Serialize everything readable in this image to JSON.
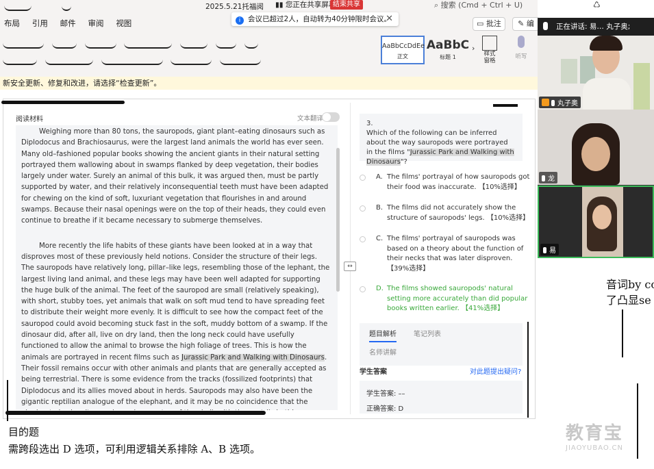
{
  "titlebar": {
    "doc_title": "2025.5.21托福阅",
    "share_status": "您正在共享屏幕",
    "stop_share": "结束共享",
    "search_placeholder": "搜索 (Cmd + Ctrl + U)"
  },
  "ribbon": {
    "tabs": [
      "布局",
      "引用",
      "邮件",
      "审阅",
      "视图"
    ],
    "comment_button": "批注",
    "edit_button": "编",
    "style_normal_sample": "AaBbCcDdEe",
    "style_normal_label": "正文",
    "style_h1_sample": "AaBbC",
    "style_h1_label": "标题 1",
    "style_pane_label": "样式\n窗格",
    "dictate_label": "听写",
    "update_hint": "新安全更新、修复和改进，请选择“检查更新”。"
  },
  "meeting": {
    "banner": "会议已超过2人，自动转为40分钟限时会议。",
    "speaking_label": "正在讲话:",
    "speaking_names": "易… 丸子奥;",
    "participants": [
      {
        "name": "丸子奥",
        "host": true
      },
      {
        "name": "龙",
        "host": false
      },
      {
        "name": "易",
        "host": false
      }
    ]
  },
  "reading": {
    "panel_title": "阅读材料",
    "translate_label": "文本翻译",
    "para1": "Weighing more than 80 tons, the sauropods, giant plant–eating dinosaurs such as Diplodocus and Brachiosaurus, were the largest land animals the world has ever seen. Many old–fashioned popular books showing the ancient giants in their natural setting portrayed them wallowing about in swamps flanked by deep vegetation, their bodies largely under water. Surely an animal of this bulk, it was argued then, must be partly supported by water, and their relatively inconsequential teeth must have been adapted for chewing on the kind of soft, luxuriant vegetation that flourishes in and around swamps. Because their nasal openings were on the top of their heads, they could even continue to breathe if it became necessary to submerge themselves.",
    "para2_before": "More recently the life habits of these giants have been looked at in a way that disproves most of these previously held notions. Consider the structure of their legs. The sauropods have relatively long, pillar–like legs, resembling those of the lephant, the largest living land animal, and these legs may have been well adapted for supporting the huge bulk of the animal. The feet of the sauropod are small (relatively speaking), with short, stubby toes, yet animals that walk on soft mud tend to have spreading feet to distribute their weight more evenly. It is difficult to see how the compact feet of the sauropod could avoid becoming stuck fast in the soft, muddy bottom of a swamp. If the dinosaur did, after all, live on dry land, then the long neck could have usefully functioned to allow the animal to browse the high foliage of trees. This is how the animals are portrayed in recent films such as ",
    "para2_highlight": "Jurassic Park and Walking with Dinosaurs",
    "para2_after": ". Their fossil remains occur with other animals and plants that are generally accepted as being terrestrial. There is some evidence from the tracks (fossilized footprints) that Diplodocus and its allies moved about in herds. Sauropods may also have been the gigantic reptilian analogue of the elephant, and it may be no coincidence that the elephant also has its nasal openings on top of the skull, with the nostrils in this case sited at the end of the trunk—it has even been suggested that some sauropods may have had a proboscis (a long flexible snout or trunk) of some sort."
  },
  "question": {
    "number": "3.",
    "stem_before": "Which of the following can be inferred about the way sauropods were portrayed in the films \"",
    "stem_highlight": "Jurassic Park and Walking with Dinosaurs",
    "stem_after": "\"?",
    "options": [
      {
        "letter": "A.",
        "text": "The films' portrayal of how sauropods got their food was inaccurate. 【10%选择】"
      },
      {
        "letter": "B.",
        "text": "The films did not accurately show the structure of sauropods' legs. 【10%选择】"
      },
      {
        "letter": "C.",
        "text": "The films' portrayal of sauropods was based on a theory about the function of their necks that was later disproven. 【39%选择】"
      },
      {
        "letter": "D.",
        "text": "The films showed sauropods' natural setting more accurately than did popular books written earlier. 【41%选择】"
      }
    ],
    "tab_analysis": "题目解析",
    "tab_notes": "笔记列表",
    "tab_teacher": "名师讲解",
    "answer_title": "学生答案",
    "ask_link": "对此题提出疑问?",
    "student_answer": "学生答案: ––",
    "correct_answer": "正确答案: D"
  },
  "doc_bottom": {
    "line1": "目的题",
    "line2": "需跨段选出 D 选项，可利用逻辑关系排除 A、B 选项。"
  },
  "side_fragments": {
    "line1": "音词by co",
    "line2": "了凸显se"
  },
  "watermark": {
    "cn": "教育宝",
    "en": "JIAOYUBAO.CN"
  },
  "colors": {
    "accent_blue": "#2468f2",
    "correct_green": "#39a83a",
    "stop_red": "#d93636",
    "active_speaker_border": "#3cbc5a",
    "host_badge": "#f39a1e"
  }
}
